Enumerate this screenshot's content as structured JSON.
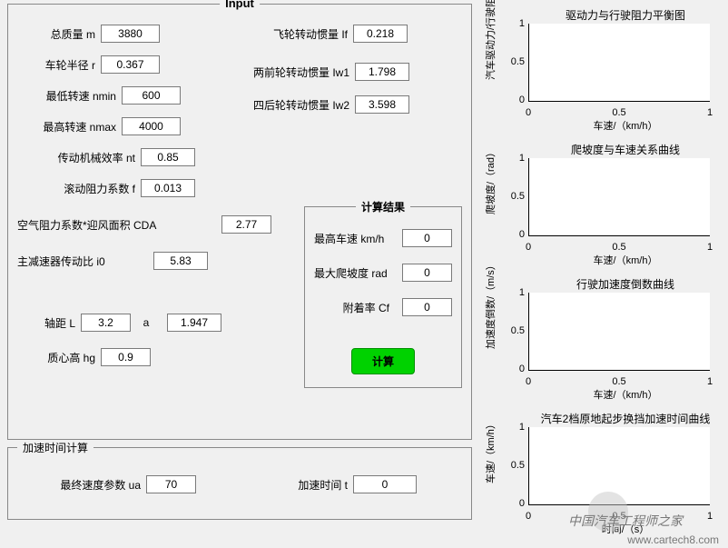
{
  "input_panel": {
    "title": "Input",
    "fields": {
      "mass": {
        "label": "总质量 m",
        "value": "3880"
      },
      "radius": {
        "label": "车轮半径 r",
        "value": "0.367"
      },
      "nmin": {
        "label": "最低转速 nmin",
        "value": "600"
      },
      "nmax": {
        "label": "最高转速 nmax",
        "value": "4000"
      },
      "nt": {
        "label": "传动机械效率 nt",
        "value": "0.85"
      },
      "f": {
        "label": "滚动阻力系数 f",
        "value": "0.013"
      },
      "cda": {
        "label": "空气阻力系数*迎风面积 CDA",
        "value": "2.77"
      },
      "i0": {
        "label": "主减速器传动比 i0",
        "value": "5.83"
      },
      "L": {
        "label": "轴距 L",
        "value": "3.2"
      },
      "a": {
        "label": "a",
        "value": "1.947"
      },
      "hg": {
        "label": "质心高 hg",
        "value": "0.9"
      },
      "If": {
        "label": "飞轮转动惯量 If",
        "value": "0.218"
      },
      "Iw1": {
        "label": "两前轮转动惯量 Iw1",
        "value": "1.798"
      },
      "Iw2": {
        "label": "四后轮转动惯量 Iw2",
        "value": "3.598"
      }
    }
  },
  "result_panel": {
    "title": "计算结果",
    "max_speed": {
      "label": "最高车速 km/h",
      "value": "0"
    },
    "max_grade": {
      "label": "最大爬坡度 rad",
      "value": "0"
    },
    "cf": {
      "label": "附着率 Cf",
      "value": "0"
    },
    "button": "计算"
  },
  "accel_panel": {
    "title": "加速时间计算",
    "ua": {
      "label": "最终速度参数 ua",
      "value": "70"
    },
    "t": {
      "label": "加速时间 t",
      "value": "0"
    }
  },
  "charts": [
    {
      "title": "驱动力与行驶阻力平衡图",
      "ylabel": "汽车驱动力/行驶阻力/N",
      "xlabel": "车速/（km/h）"
    },
    {
      "title": "爬坡度与车速关系曲线",
      "ylabel": "爬坡度/（rad）",
      "xlabel": "车速/（km/h）"
    },
    {
      "title": "行驶加速度倒数曲线",
      "ylabel": "加速度倒数/（m/s）",
      "xlabel": "车速/（km/h）"
    },
    {
      "title": "汽车2档原地起步换挡加速时间曲线",
      "ylabel": "车速/（km/h）",
      "xlabel": "时间/（s）"
    }
  ],
  "chart_axes": {
    "yticks": [
      "1",
      "0.5",
      "0"
    ],
    "xticks": [
      "0",
      "0.5",
      "1"
    ]
  },
  "watermark": {
    "text": "中国汽车工程师之家",
    "url": "www.cartech8.com"
  }
}
